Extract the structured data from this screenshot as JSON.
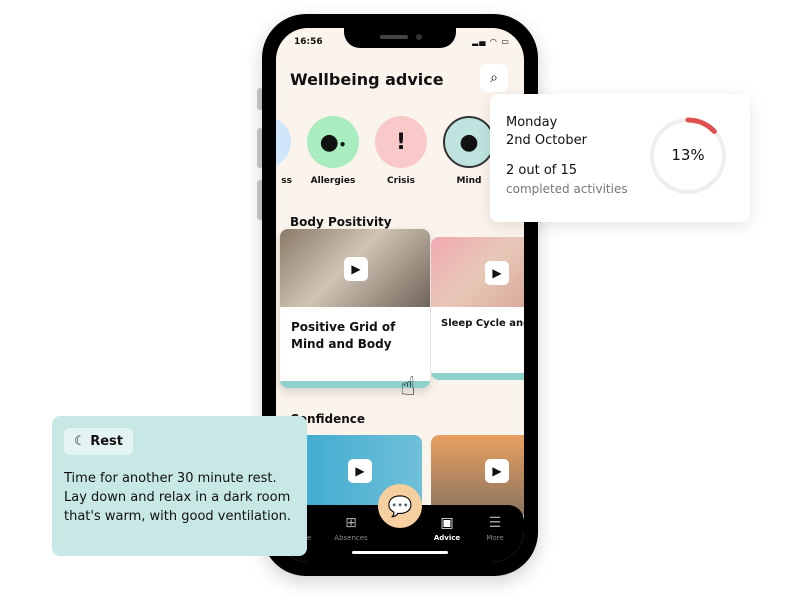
{
  "status_bar": {
    "time": "16:56",
    "icons": "signal wifi battery"
  },
  "header": {
    "title": "Wellbeing advice",
    "search_icon": "search-icon"
  },
  "categories": [
    {
      "label": "ss",
      "color": "#cfe6fb"
    },
    {
      "label": "Allergies",
      "color": "#a8ecc0",
      "icon": "bubbles"
    },
    {
      "label": "Crisis",
      "color": "#f9c8c8",
      "icon": "!"
    },
    {
      "label": "Mind",
      "color": "#bfe4df",
      "icon": "head-brain",
      "selected": true
    }
  ],
  "sections": [
    {
      "title": "Body Positivity",
      "videos": [
        {
          "title": "Positive Grid of Mind and Body"
        },
        {
          "title": "Sleep Cycle and Body Positivity"
        }
      ]
    },
    {
      "title": "Confidence"
    }
  ],
  "nav": {
    "items": [
      {
        "label": "Home"
      },
      {
        "label": "Absences"
      },
      {
        "label": "Advice",
        "active": true
      },
      {
        "label": "More"
      }
    ]
  },
  "progress_card": {
    "day": "Monday",
    "date": "2nd October",
    "count": "2 out of 15",
    "caption": "completed activities",
    "percent_label": "13%",
    "percent": 13,
    "accent": "#e05050"
  },
  "rest_card": {
    "tag": "Rest",
    "text": "Time for another 30 minute rest. Lay down and relax in a dark room that's warm, with good ventilation.",
    "color": "#c8e8e6"
  }
}
